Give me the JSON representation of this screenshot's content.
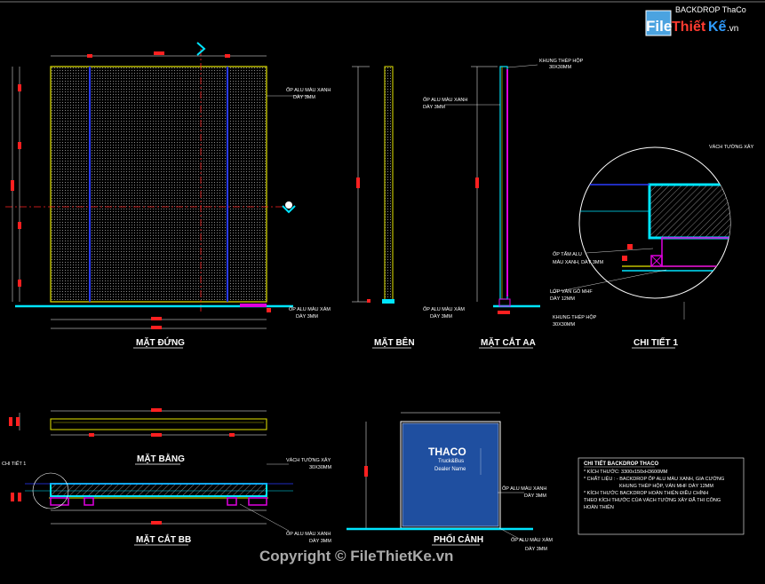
{
  "header": {
    "logo_tl": "File",
    "logo_mid": "Thiết",
    "logo_tr": "Kế",
    "logo_suffix": ".vn",
    "project_title": "BACKDROP ThaCo"
  },
  "views": {
    "front": "MẶT ĐỨNG",
    "side": "MẶT BÊN",
    "section_aa": "MẶT CẮT AA",
    "detail_1": "CHI TIẾT 1",
    "plan": "MẶT BẰNG",
    "section_bb": "MẶT CẮT BB",
    "perspective": "PHỐI CẢNH"
  },
  "front_labels": {
    "op_alu_title": "ỐP ALU MÀU XANH",
    "op_alu_thk": "DÀY 3MM",
    "bottom_op_title": "ỐP ALU MÀU XÁM",
    "bottom_op_thk": "DÀY 3MM"
  },
  "section_aa_labels": {
    "frame_title": "KHUNG THÉP HỘP",
    "frame_size": "30X30MM",
    "op_title": "ỐP ALU MÀU XANH",
    "op_thk": "DÀY 3MM",
    "bottom_title": "ỐP ALU MÀU XÁM",
    "bottom_thk": "DÀY 3MM"
  },
  "detail_labels": {
    "wall": "VÁCH TƯỜNG XÂY",
    "op_tam_1": "ỐP TẤM ALU",
    "op_tam_2": "MÀU XANH, DÀY 3MM",
    "mdf_1": "LỚP VÁN GỖ MHF",
    "mdf_2": "DÀY 12MM",
    "frame_1": "KHUNG THÉP HỘP",
    "frame_2": "30X30MM"
  },
  "bb_labels": {
    "detail_ref": "CHI TIẾT 1",
    "wall_1": "VÁCH TƯỜNG XÂY",
    "wall_2": "30X30MM",
    "op_1": "ỐP ALU MÀU XANH",
    "op_2": "DÀY 3MM"
  },
  "perspective_labels": {
    "brand": "THACO",
    "sub": "Truck&Bus",
    "dealer": "Dealer Name",
    "op_xanh_1": "ỐP ALU MÀU XANH",
    "op_xanh_2": "DÀY 3MM",
    "op_xam_1": "ỐP ALU MÀU XÁM",
    "op_xam_2": "DÀY 3MM"
  },
  "spec_box": {
    "title": "CHI TIẾT BACKDROP THACO",
    "lines": [
      "* KÍCH THƯỚC: 3300x150xH3600MM",
      "* CHẤT LIỆU : - BACKDROP ỐP ALU MÀU XANH, GIA CƯỜNG",
      "KHUNG THÉP HỘP, VÁN MHF DÀY 12MM",
      "* KÍCH THƯỚC BACKDROP HOÀN THIỆN ĐIỀU CHỈNH",
      "THEO KÍCH THƯỚC CỦA VÁCH TƯỜNG XÂY ĐÃ THI CÔNG",
      "HOÀN THIỆN"
    ]
  },
  "footer": {
    "copyright": "Copyright © FileThietKe.vn"
  },
  "colors": {
    "background": "#000000",
    "panel_outline": "#e6e600",
    "accent_cyan": "#00e5ff",
    "accent_magenta": "#e000e0",
    "panel_blue": "#1f4fa0",
    "dim_red": "#ff2020"
  }
}
